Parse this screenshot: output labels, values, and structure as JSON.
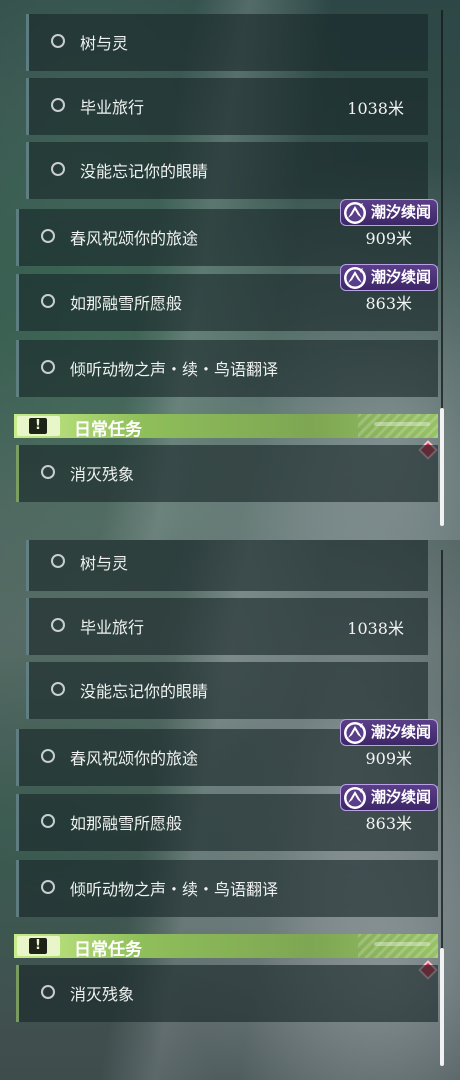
{
  "panels": [
    {
      "quests": [
        {
          "label": "树与灵",
          "distance": ""
        },
        {
          "label": "毕业旅行",
          "distance": "1038米"
        },
        {
          "label": "没能忘记你的眼睛",
          "distance": ""
        },
        {
          "label": "春风祝颂你的旅途",
          "distance": "909米",
          "badge": "潮汐续闻"
        },
        {
          "label": "如那融雪所愿般",
          "distance": "863米",
          "badge": "潮汐续闻"
        },
        {
          "label": "倾听动物之声・续・鸟语翻译",
          "distance": ""
        }
      ],
      "section_title": "日常任务",
      "section_icon": "!",
      "daily_quests": [
        {
          "label": "消灭残象"
        }
      ]
    },
    {
      "quests": [
        {
          "label": "树与灵",
          "distance": ""
        },
        {
          "label": "毕业旅行",
          "distance": "1038米"
        },
        {
          "label": "没能忘记你的眼睛",
          "distance": ""
        },
        {
          "label": "春风祝颂你的旅途",
          "distance": "909米",
          "badge": "潮汐续闻"
        },
        {
          "label": "如那融雪所愿般",
          "distance": "863米",
          "badge": "潮汐续闻"
        },
        {
          "label": "倾听动物之声・续・鸟语翻译",
          "distance": ""
        }
      ],
      "section_title": "日常任务",
      "section_icon": "!",
      "daily_quests": [
        {
          "label": "消灭残象"
        }
      ]
    }
  ],
  "colors": {
    "badge_purple": "#4b3277",
    "section_green": "#9ccb68",
    "marker_red": "#d2334d"
  },
  "icons": {
    "badge": "tide-event-icon",
    "section": "exclamation-icon",
    "quest": "circle-icon",
    "marker": "diamond-marker-icon"
  }
}
